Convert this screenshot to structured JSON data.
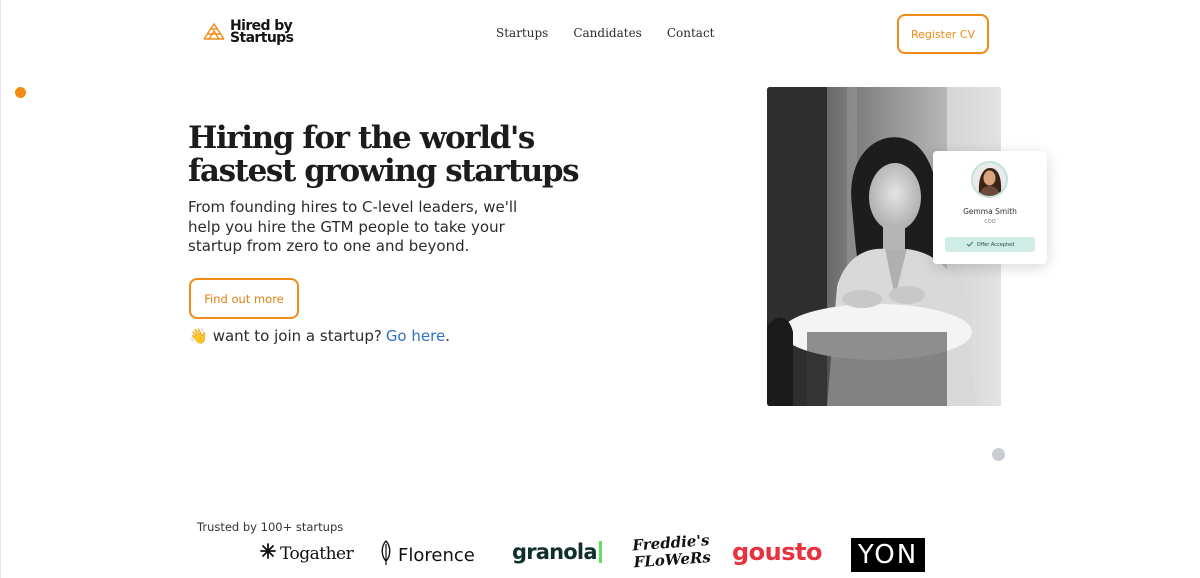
{
  "header": {
    "logo_line1": "Hired by",
    "logo_line2": "Startups",
    "nav": [
      "Startups",
      "Candidates",
      "Contact"
    ],
    "register_label": "Register CV"
  },
  "hero": {
    "title": "Hiring for the world's fastest growing startups",
    "subtitle": "From founding hires to C-level leaders, we'll help you hire the GTM people to take your startup from zero to one and beyond.",
    "cta_label": "Find out more",
    "join_emoji": "👋",
    "join_text": "want to join a startup?",
    "join_link": "Go here",
    "join_period": "."
  },
  "profile_card": {
    "name": "Gemma Smith",
    "role": "COO",
    "badge": "Offer Accepted",
    "badge_icon": "check-icon"
  },
  "trusted": {
    "label": "Trusted by 100+ startups",
    "logos": {
      "togather": "Togather",
      "florence": "Florence",
      "granola": "granola",
      "freddies_line1": "Freddie's",
      "freddies_line2": "FLoWeRs",
      "gousto": "gousto",
      "yon": "YON"
    }
  },
  "colors": {
    "accent": "#f08b16",
    "link": "#2d6fc7",
    "badge_bg": "#cfece6",
    "gousto_red": "#e8323f",
    "granola_green": "#5ee05a"
  }
}
